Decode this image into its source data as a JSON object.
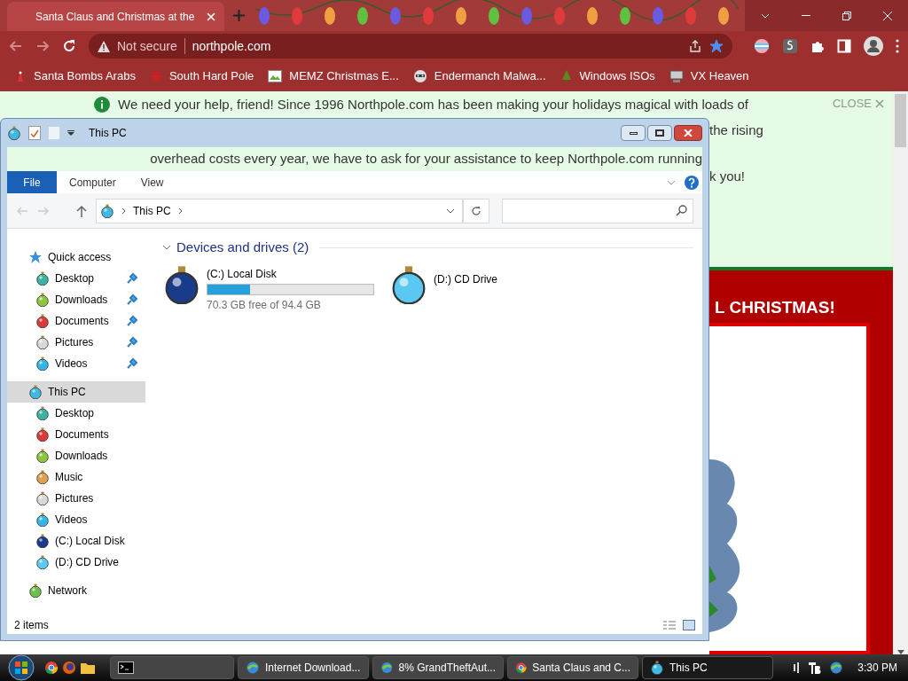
{
  "browser": {
    "tab": {
      "title": "Santa Claus and Christmas at the",
      "selected": true
    },
    "address": {
      "security": "Not secure",
      "url": "northpole.com",
      "starred": true
    },
    "bookmarks": [
      {
        "kind": "santa",
        "label": "Santa Bombs Arabs"
      },
      {
        "kind": "snowflake",
        "label": "South Hard Pole"
      },
      {
        "kind": "image",
        "label": "MEMZ Christmas E..."
      },
      {
        "kind": "raccoon",
        "label": "Endermanch Malwa..."
      },
      {
        "kind": "tree",
        "label": "Windows ISOs"
      },
      {
        "kind": "computer",
        "label": "VX Heaven"
      }
    ]
  },
  "page": {
    "banner": {
      "line": "We need your help, friend! Since 1996 Northpole.com has been making your holidays magical with loads of",
      "line_2_end": "the rising",
      "line_4_end": "k you!",
      "close": "CLOSE"
    },
    "heading": "L CHRISTMAS!"
  },
  "explorer": {
    "title": "This PC",
    "overlay_text": "overhead costs every year, we have to ask for your assistance to keep Northpole.com running",
    "ribbon_tabs": [
      {
        "label": "File",
        "selected": true
      },
      {
        "label": "Computer",
        "selected": false
      },
      {
        "label": "View",
        "selected": false
      }
    ],
    "breadcrumb": "This PC",
    "nav": [
      {
        "kind": "star",
        "label": "Quick access",
        "selected": false,
        "children": [
          {
            "kind": "desktop",
            "label": "Desktop",
            "pinned": true,
            "selected": false
          },
          {
            "kind": "downloads",
            "label": "Downloads",
            "pinned": true,
            "selected": false
          },
          {
            "kind": "documents",
            "label": "Documents",
            "pinned": true,
            "selected": false
          },
          {
            "kind": "pictures",
            "label": "Pictures",
            "pinned": true,
            "selected": false
          },
          {
            "kind": "videos",
            "label": "Videos",
            "pinned": true,
            "selected": false
          }
        ]
      },
      {
        "kind": "pc",
        "label": "This PC",
        "selected": true,
        "children": [
          {
            "kind": "desktop",
            "label": "Desktop",
            "pinned": false,
            "selected": false
          },
          {
            "kind": "documents",
            "label": "Documents",
            "pinned": false,
            "selected": false
          },
          {
            "kind": "downloads",
            "label": "Downloads",
            "pinned": false,
            "selected": false
          },
          {
            "kind": "music",
            "label": "Music",
            "pinned": false,
            "selected": false
          },
          {
            "kind": "pictures",
            "label": "Pictures",
            "pinned": false,
            "selected": false
          },
          {
            "kind": "videos",
            "label": "Videos",
            "pinned": false,
            "selected": false
          },
          {
            "kind": "disk",
            "label": "(C:) Local Disk",
            "pinned": false,
            "selected": false
          },
          {
            "kind": "cd",
            "label": "(D:) CD Drive",
            "pinned": false,
            "selected": false
          }
        ]
      },
      {
        "kind": "network",
        "label": "Network",
        "selected": false
      }
    ],
    "group": "Devices and drives (2)",
    "drives": [
      {
        "kind": "disk",
        "name": "(C:) Local Disk",
        "level": 0.255,
        "free": "70.3 GB free of 94.4 GB"
      },
      {
        "kind": "cd",
        "name": "(D:) CD Drive"
      }
    ],
    "status": "2 items"
  },
  "taskbar": {
    "tasks": [
      {
        "kind": "console",
        "selected": false
      },
      {
        "kind": "download",
        "label": "Internet Download...",
        "selected": false
      },
      {
        "kind": "download",
        "label": "8% GrandTheftAut...",
        "selected": false
      },
      {
        "kind": "chrome",
        "label": "Santa Claus and C...",
        "selected": false
      },
      {
        "kind": "explorer",
        "label": "This PC",
        "selected": true
      }
    ],
    "clock": "3:30 PM"
  }
}
